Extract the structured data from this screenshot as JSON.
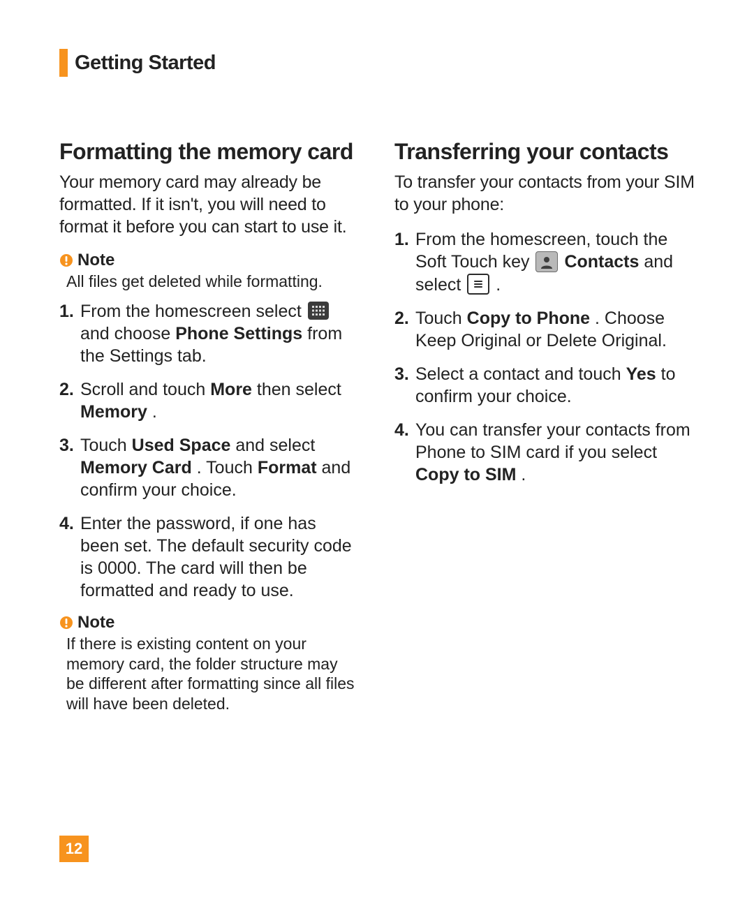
{
  "header": {
    "section_title": "Getting Started"
  },
  "left": {
    "heading": "Formatting the memory card",
    "intro": "Your memory card may already be formatted. If it isn't, you will need to format it before you can start to use it.",
    "note1": {
      "label": "Note",
      "text": "All files get deleted while formatting."
    },
    "steps": {
      "s1a": "From the homescreen select ",
      "s1b": " and choose ",
      "s1c": "Phone Settings",
      "s1d": " from the Settings tab.",
      "s2a": "Scroll and touch ",
      "s2b": "More",
      "s2c": " then select ",
      "s2d": "Memory",
      "s2e": ".",
      "s3a": "Touch ",
      "s3b": "Used Space",
      "s3c": " and select ",
      "s3d": "Memory Card",
      "s3e": ". Touch ",
      "s3f": "Format",
      "s3g": " and confirm your choice.",
      "s4": "Enter the password, if one has been set. The default security code is 0000. The card will then be formatted and ready to use."
    },
    "note2": {
      "label": "Note",
      "text": "If there is existing content on your memory card, the folder structure may be different after formatting since all files will have been deleted."
    }
  },
  "right": {
    "heading": "Transferring your contacts",
    "intro": "To transfer your contacts from your SIM to your phone:",
    "steps": {
      "s1a": "From the homescreen, touch the Soft Touch key ",
      "s1b": "Contacts",
      "s1c": " and select ",
      "s1d": ".",
      "s2a": "Touch ",
      "s2b": "Copy to Phone",
      "s2c": ". Choose Keep Original or Delete Original.",
      "s3a": "Select a contact and touch ",
      "s3b": "Yes",
      "s3c": " to confirm your choice.",
      "s4a": "You can transfer your contacts from Phone to SIM card if you select ",
      "s4b": "Copy to SIM",
      "s4c": "."
    }
  },
  "page_number": "12",
  "colors": {
    "accent": "#f7931e"
  }
}
